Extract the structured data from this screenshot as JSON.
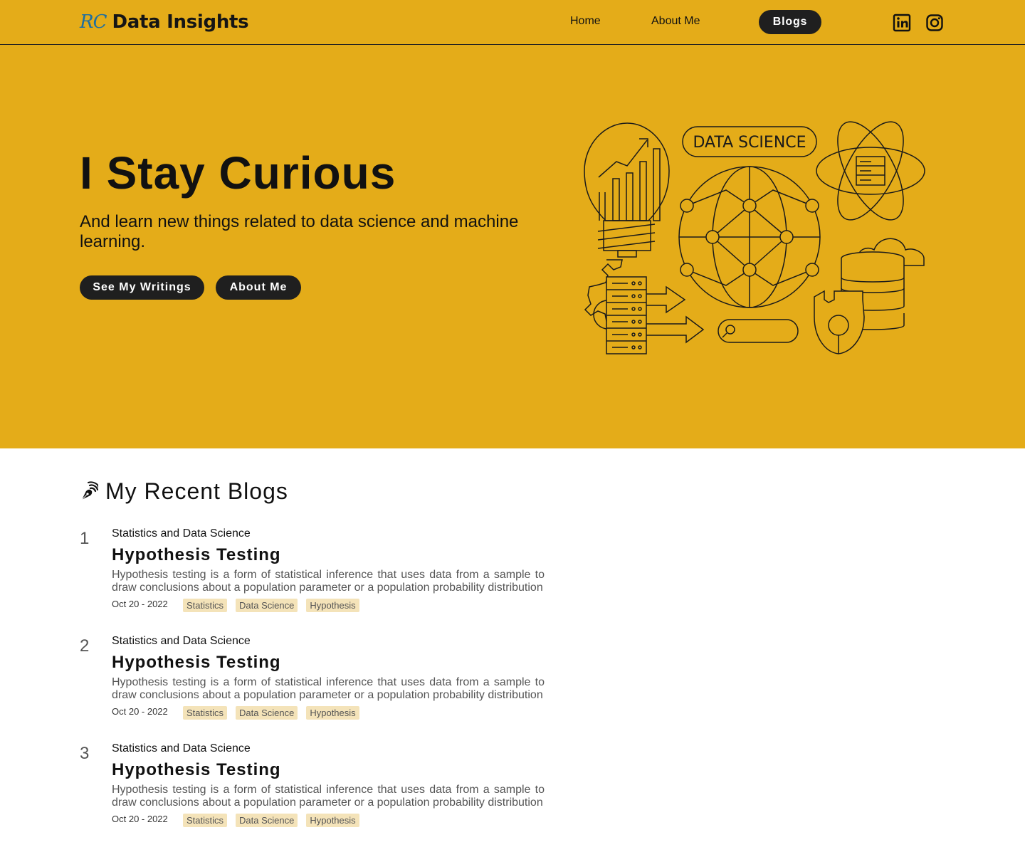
{
  "header": {
    "brand_mark": "RC",
    "brand_name": "Data Insights",
    "nav": {
      "home": "Home",
      "about": "About Me",
      "blogs": "Blogs"
    }
  },
  "hero": {
    "title": "I Stay Curious",
    "subtitle": "And learn new things related to data science and machine learning.",
    "btn_writings": "See My Writings",
    "btn_about": "About Me",
    "illustration_text": "DATA SCIENCE"
  },
  "blogs": {
    "heading": "My Recent Blogs",
    "posts": [
      {
        "num": "1",
        "category": "Statistics and Data Science",
        "title": "Hypothesis Testing",
        "description": "Hypothesis testing is a form of statistical inference that uses data from a sample to draw conclusions about a population parameter or a population probability distribution",
        "date": "Oct 20 - 2022",
        "tags": [
          "Statistics",
          "Data Science",
          "Hypothesis"
        ]
      },
      {
        "num": "2",
        "category": "Statistics and Data Science",
        "title": "Hypothesis Testing",
        "description": "Hypothesis testing is a form of statistical inference that uses data from a sample to draw conclusions about a population parameter or a population probability distribution",
        "date": "Oct 20 - 2022",
        "tags": [
          "Statistics",
          "Data Science",
          "Hypothesis"
        ]
      },
      {
        "num": "3",
        "category": "Statistics and Data Science",
        "title": "Hypothesis Testing",
        "description": "Hypothesis testing is a form of statistical inference that uses data from a sample to draw conclusions about a population parameter or a population probability distribution",
        "date": "Oct 20 - 2022",
        "tags": [
          "Statistics",
          "Data Science",
          "Hypothesis"
        ]
      }
    ]
  },
  "colors": {
    "accent": "#e4ac19",
    "dark": "#1f1f1f",
    "tag_bg": "#f4e3b9",
    "brand_blue": "#1e6fa0"
  },
  "icons": {
    "linkedin": "linkedin-icon",
    "instagram": "instagram-icon",
    "pen": "pen-icon"
  }
}
